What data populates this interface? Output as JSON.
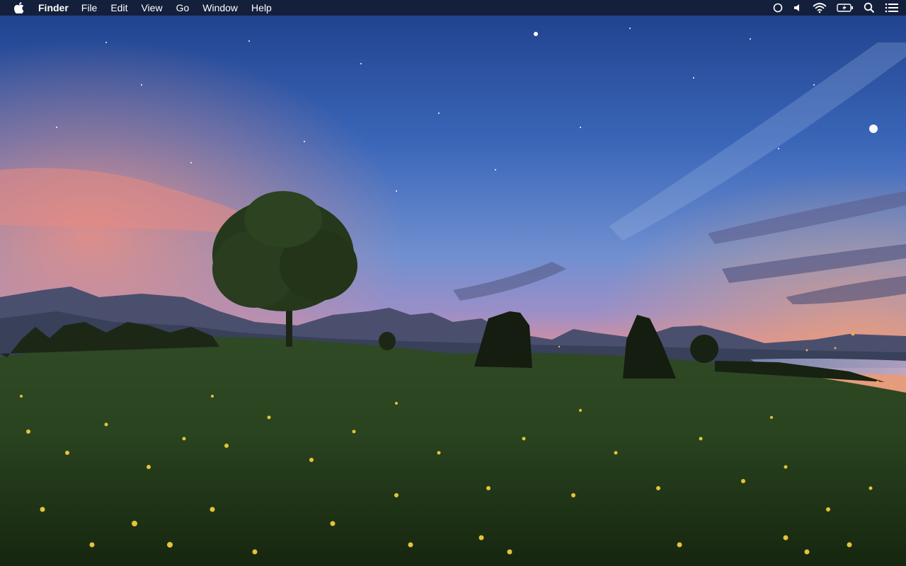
{
  "menubar": {
    "apple_icon": "apple-logo-icon",
    "app_name": "Finder",
    "items": [
      "File",
      "Edit",
      "View",
      "Go",
      "Window",
      "Help"
    ],
    "status_icons": [
      "siri-circle-icon",
      "volume-icon",
      "wifi-icon",
      "battery-charging-icon",
      "spotlight-search-icon",
      "notification-center-icon"
    ]
  },
  "desktop": {
    "wallpaper": "meadow-night-landscape-with-tree-and-mountains"
  },
  "colors": {
    "menubar_bg": "#121c34",
    "menubar_text": "#ffffff"
  }
}
